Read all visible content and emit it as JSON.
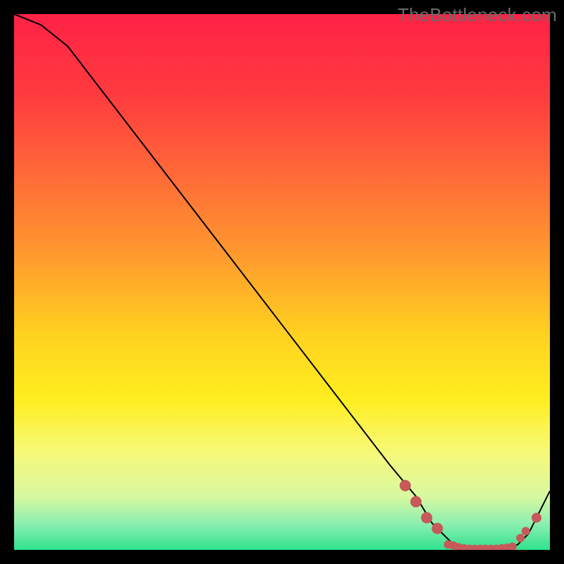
{
  "watermark": "TheBottleneck.com",
  "chart_data": {
    "type": "line",
    "title": "",
    "xlabel": "",
    "ylabel": "",
    "xlim": [
      0,
      100
    ],
    "ylim": [
      0,
      100
    ],
    "series": [
      {
        "name": "bottleneck-curve",
        "x": [
          0,
          5,
          10,
          20,
          30,
          40,
          50,
          60,
          70,
          75,
          78,
          80,
          82,
          84,
          86,
          88,
          90,
          92,
          94,
          96,
          98,
          100
        ],
        "y": [
          100,
          98,
          94,
          81,
          68,
          55,
          42,
          29,
          16,
          10,
          5,
          3,
          1,
          0,
          0,
          0,
          0,
          0,
          1,
          3,
          7,
          11
        ]
      }
    ],
    "markers": {
      "name": "highlight-points",
      "color": "#c65a5a",
      "x": [
        73,
        75,
        77,
        79,
        81,
        82,
        83,
        84,
        85,
        86,
        87,
        88,
        89,
        90,
        91,
        92,
        93,
        94.5,
        95.5,
        97.5
      ],
      "y": [
        12,
        9,
        6,
        4,
        1,
        0.8,
        0.5,
        0.3,
        0.2,
        0.2,
        0.2,
        0.2,
        0.2,
        0.2,
        0.3,
        0.4,
        0.6,
        2.2,
        3.5,
        6.0
      ],
      "r": [
        8,
        8,
        8,
        8,
        6,
        6,
        6,
        6,
        6,
        6,
        6,
        6,
        6,
        6,
        6,
        6,
        6,
        6,
        6,
        7
      ]
    },
    "gradient": {
      "stops": [
        {
          "offset": 0.0,
          "color": "#ff2246"
        },
        {
          "offset": 0.15,
          "color": "#ff3b3f"
        },
        {
          "offset": 0.3,
          "color": "#ff6a38"
        },
        {
          "offset": 0.45,
          "color": "#ff9a2e"
        },
        {
          "offset": 0.6,
          "color": "#ffd21f"
        },
        {
          "offset": 0.72,
          "color": "#ffee20"
        },
        {
          "offset": 0.82,
          "color": "#f6f97a"
        },
        {
          "offset": 0.9,
          "color": "#d8f8a0"
        },
        {
          "offset": 0.95,
          "color": "#8eefb0"
        },
        {
          "offset": 1.0,
          "color": "#2fe28e"
        }
      ]
    }
  }
}
